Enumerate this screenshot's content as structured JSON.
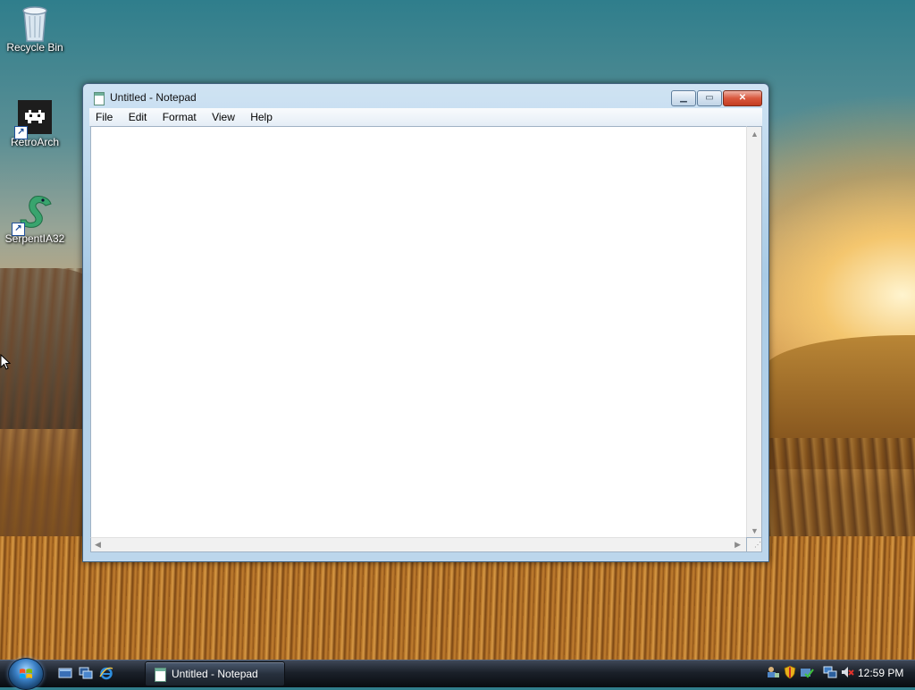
{
  "desktop": {
    "icons": [
      {
        "label": "Recycle Bin",
        "icon": "recycle-bin-icon"
      },
      {
        "label": "RetroArch",
        "icon": "retroarch-icon"
      },
      {
        "label": "SerpentIA32",
        "icon": "serpent-icon"
      }
    ]
  },
  "window": {
    "title": "Untitled - Notepad",
    "menu": [
      "File",
      "Edit",
      "Format",
      "View",
      "Help"
    ],
    "content": ""
  },
  "taskbar": {
    "task_label": "Untitled - Notepad",
    "clock": "12:59 PM"
  }
}
